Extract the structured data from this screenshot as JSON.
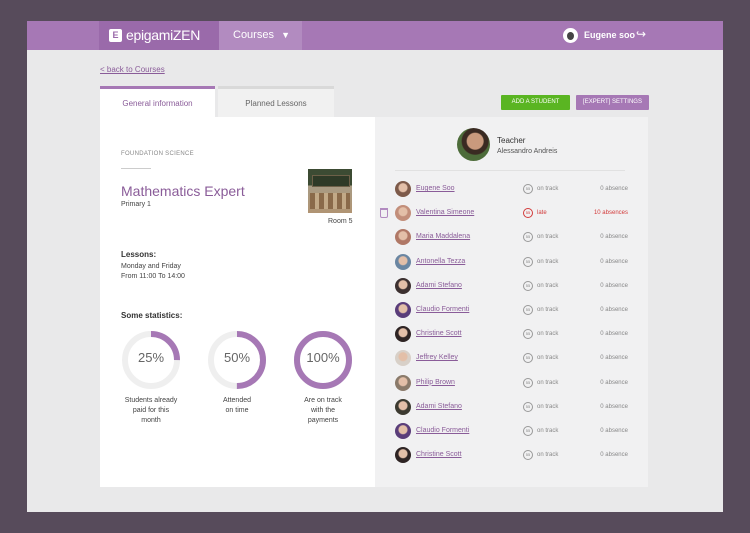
{
  "app": {
    "logo_letter": "E",
    "brand": "epigamiZEN",
    "nav_courses": "Courses",
    "user_name": "Eugene soo"
  },
  "icons": {
    "logo": "epigami-logo-icon",
    "chevron": "chevron-down-icon",
    "logout": "logout-icon",
    "trash": "trash-icon",
    "status": "status-circle-icon"
  },
  "colors": {
    "brand": "#a678b5",
    "green": "#5ab522",
    "late": "#d23a3a"
  },
  "back_link": "< back to Courses",
  "tabs": [
    {
      "label": "General information",
      "active": true
    },
    {
      "label": "Planned Lessons",
      "active": false
    }
  ],
  "actions": {
    "add_student": "ADD A STUDENT",
    "expert_settings": "[EXPERT] SETTINGS"
  },
  "course": {
    "subject": "FOUNDATION SCIENCE",
    "title": "Mathematics Expert",
    "grade": "Primary 1",
    "room": "Room 5",
    "lessons_heading": "Lessons:",
    "lessons_days": "Monday and Friday",
    "lessons_time": "From 11:00 To 14:00",
    "stats_heading": "Some statistics:",
    "stats": [
      {
        "value": "25%",
        "fraction": 0.25,
        "caption": [
          "Students already",
          "paid for this",
          "month"
        ]
      },
      {
        "value": "50%",
        "fraction": 0.5,
        "caption": [
          "Attended",
          "on time"
        ]
      },
      {
        "value": "100%",
        "fraction": 1.0,
        "caption": [
          "Are on track",
          "with the",
          "payments"
        ]
      }
    ]
  },
  "teacher": {
    "role": "Teacher",
    "name": "Alessandro Andreis"
  },
  "students": [
    {
      "name": "Eugene Soo",
      "icon_text": "55",
      "status": "on track",
      "absence": "0 absence",
      "late": false
    },
    {
      "name": "Valentina Simeone",
      "icon_text": "55",
      "status": "late",
      "absence": "10 absences",
      "late": true
    },
    {
      "name": "Maria Maddalena",
      "icon_text": "55",
      "status": "on track",
      "absence": "0 absence",
      "late": false
    },
    {
      "name": "Antonella Tezza",
      "icon_text": "55",
      "status": "on track",
      "absence": "0 absence",
      "late": false
    },
    {
      "name": "Adami Stefano",
      "icon_text": "55",
      "status": "on track",
      "absence": "0 absence",
      "late": false
    },
    {
      "name": "Claudio Formenti",
      "icon_text": "55",
      "status": "on track",
      "absence": "0 absence",
      "late": false
    },
    {
      "name": "Christine Scott",
      "icon_text": "55",
      "status": "on track",
      "absence": "0 absence",
      "late": false
    },
    {
      "name": "Jeffrey Kelley",
      "icon_text": "55",
      "status": "on track",
      "absence": "0 absence",
      "late": false
    },
    {
      "name": "Philip Brown",
      "icon_text": "55",
      "status": "on track",
      "absence": "0 absence",
      "late": false
    },
    {
      "name": "Adami Stefano",
      "icon_text": "55",
      "status": "on track",
      "absence": "0 absence",
      "late": false
    },
    {
      "name": "Claudio Formenti",
      "icon_text": "55",
      "status": "on track",
      "absence": "0 absence",
      "late": false
    },
    {
      "name": "Christine Scott",
      "icon_text": "55",
      "status": "on track",
      "absence": "0 absence",
      "late": false
    }
  ]
}
